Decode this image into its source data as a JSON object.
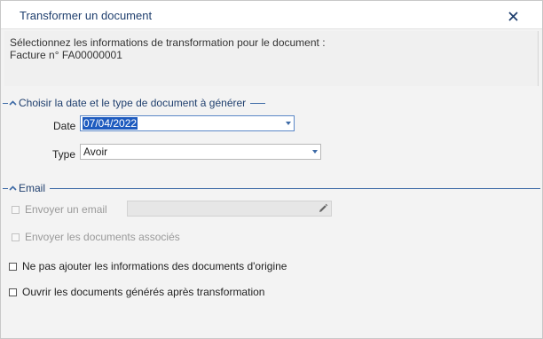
{
  "dialog": {
    "title": "Transformer un document",
    "close_icon": "close-icon"
  },
  "info": {
    "line1": "Sélectionnez les informations de transformation pour le document :",
    "line2": "Facture n° FA00000001"
  },
  "section_date_type": {
    "label": "Choisir la date et le type de document à générer",
    "icon": "chevron-up-icon",
    "date_label": "Date",
    "date_value": "07/04/2022",
    "type_label": "Type",
    "type_value": "Avoir"
  },
  "section_email": {
    "label": "Email",
    "icon": "chevron-up-icon",
    "send_email_label": "Envoyer un email",
    "send_email_checked": false,
    "send_email_enabled": false,
    "email_value": "",
    "send_docs_label": "Envoyer les documents associés",
    "send_docs_checked": false,
    "send_docs_enabled": false
  },
  "options": {
    "no_origin_info_label": "Ne pas ajouter les informations des documents d'origine",
    "no_origin_info_checked": false,
    "open_generated_label": "Ouvrir les documents générés après transformation",
    "open_generated_checked": false
  },
  "colors": {
    "accent": "#3d6aa6",
    "title_text": "#1f3f6e",
    "selection": "#1e5bbf"
  }
}
